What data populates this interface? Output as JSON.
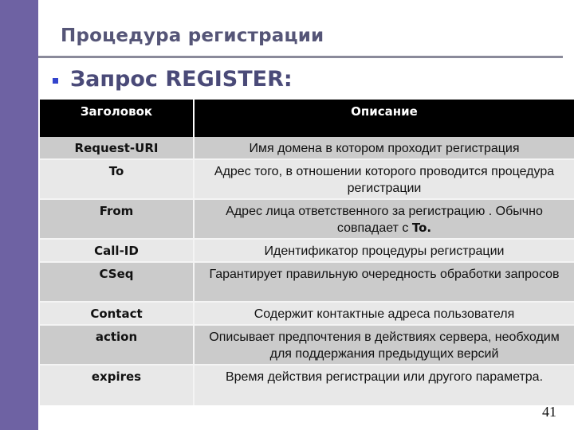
{
  "slide": {
    "title": "Процедура регистрации",
    "subheading": "Запрос REGISTER:",
    "page_number": "41",
    "colors": {
      "sidebar": "#6e62a3",
      "title_text": "#555577",
      "subheading_text": "#4a4a78",
      "bullet": "#3344cc",
      "table_header_bg": "#000000",
      "row_dark_bg": "#cbcbcb",
      "row_light_bg": "#e8e8e8"
    }
  },
  "table": {
    "columns": [
      "Заголовок",
      "Описание"
    ],
    "rows": [
      {
        "name": "Request-URI",
        "description": "Имя домена в котором проходит регистрация"
      },
      {
        "name": "To",
        "description": "Адрес того, в отношении которого проводится процедура регистрации"
      },
      {
        "name": "From",
        "description": "Адрес лица ответственного за регистрацию . Обычно совпадает с",
        "description_bold_suffix": "To."
      },
      {
        "name": "Call-ID",
        "description": "Идентификатор процедуры регистрации"
      },
      {
        "name": "CSeq",
        "description": "Гарантирует правильную очередность обработки запросов"
      },
      {
        "name": "Contact",
        "description": "Содержит контактные адреса пользователя"
      },
      {
        "name": "action",
        "description": "Описывает предпочтения в действиях сервера, необходим для поддержания предыдущих версий"
      },
      {
        "name": "expires",
        "description": "Время действия регистрации или другого параметра."
      }
    ]
  }
}
